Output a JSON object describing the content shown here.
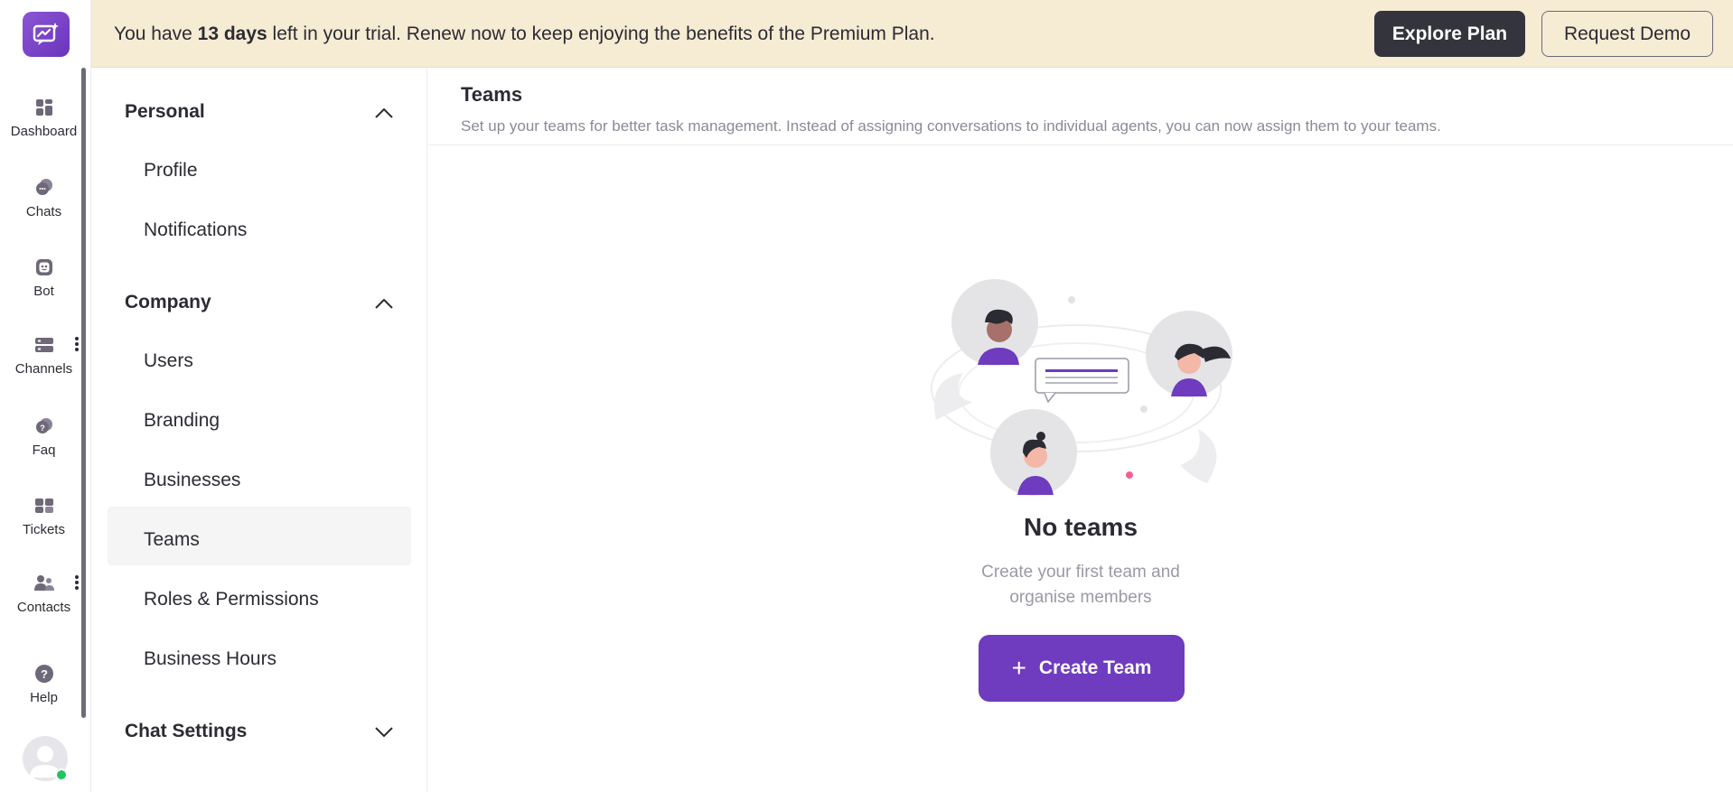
{
  "nav": {
    "items": [
      {
        "label": "Dashboard",
        "icon": "dashboard-icon"
      },
      {
        "label": "Chats",
        "icon": "chat-bubbles-icon"
      },
      {
        "label": "Bot",
        "icon": "bot-icon"
      },
      {
        "label": "Channels",
        "icon": "channels-icon"
      },
      {
        "label": "Faq",
        "icon": "faq-icon"
      },
      {
        "label": "Tickets",
        "icon": "tickets-icon"
      },
      {
        "label": "Contacts",
        "icon": "contacts-icon"
      },
      {
        "label": "Help",
        "icon": "help-icon"
      }
    ],
    "user_status_color": "#22c55e"
  },
  "banner": {
    "prefix": "You have ",
    "days": "13 days",
    "suffix": " left in your trial. Renew now to keep enjoying the benefits of the Premium Plan.",
    "explore_label": "Explore Plan",
    "demo_label": "Request Demo"
  },
  "settings": {
    "personal": {
      "title": "Personal",
      "items": [
        "Profile",
        "Notifications"
      ]
    },
    "company": {
      "title": "Company",
      "items": [
        "Users",
        "Branding",
        "Businesses",
        "Teams",
        "Roles & Permissions",
        "Business Hours"
      ],
      "active": "Teams"
    },
    "chat_settings": {
      "title": "Chat Settings"
    }
  },
  "main": {
    "title": "Teams",
    "subtitle": "Set up your teams for better task management. Instead of assigning conversations to individual agents, you can now assign them to your teams.",
    "empty_title": "No teams",
    "empty_subtitle": "Create your first team and organise members",
    "create_label": "Create Team"
  },
  "colors": {
    "accent": "#6f3bbf",
    "banner_bg": "#f6ebd3",
    "dark_button": "#34343c"
  }
}
